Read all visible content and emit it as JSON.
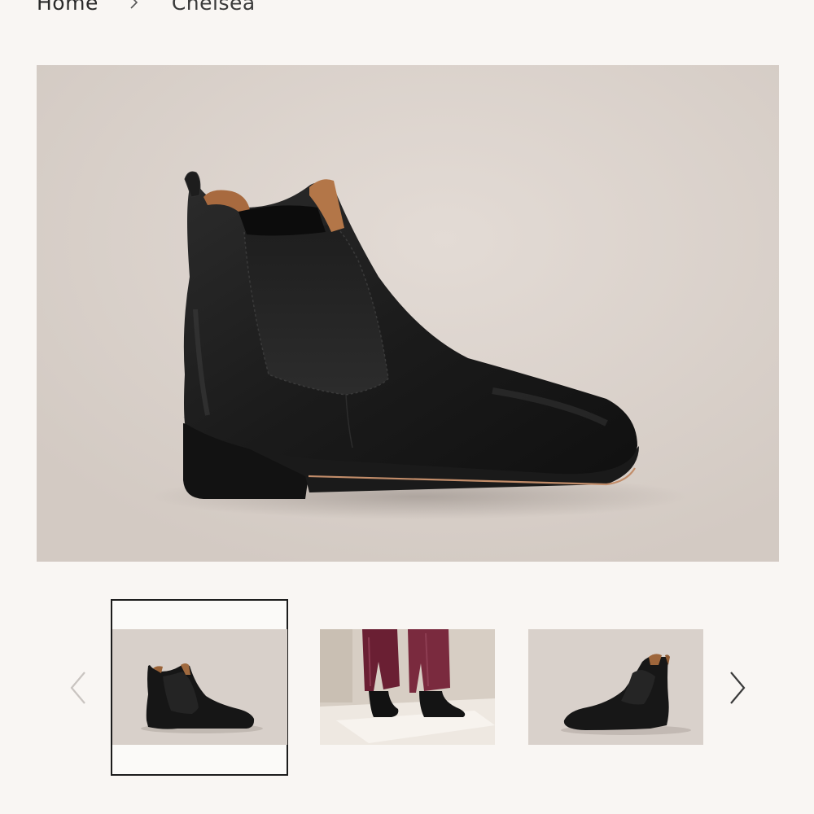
{
  "breadcrumb": {
    "items": [
      {
        "label": "Home"
      },
      {
        "label": "Chelsea"
      }
    ]
  },
  "main_image": {
    "icon": "product-photo-black-chelsea-boot"
  },
  "carousel": {
    "selected_index": 0,
    "thumbnails": [
      {
        "icon": "black-chelsea-boot-side-thumbnail"
      },
      {
        "icon": "model-wearing-boots-thumbnail"
      },
      {
        "icon": "black-chelsea-boot-angle-thumbnail"
      }
    ],
    "prev_icon": "chevron-left-icon",
    "next_icon": "chevron-right-icon"
  },
  "colors": {
    "background": "#f9f6f3",
    "accent": "#1c1c1c"
  }
}
